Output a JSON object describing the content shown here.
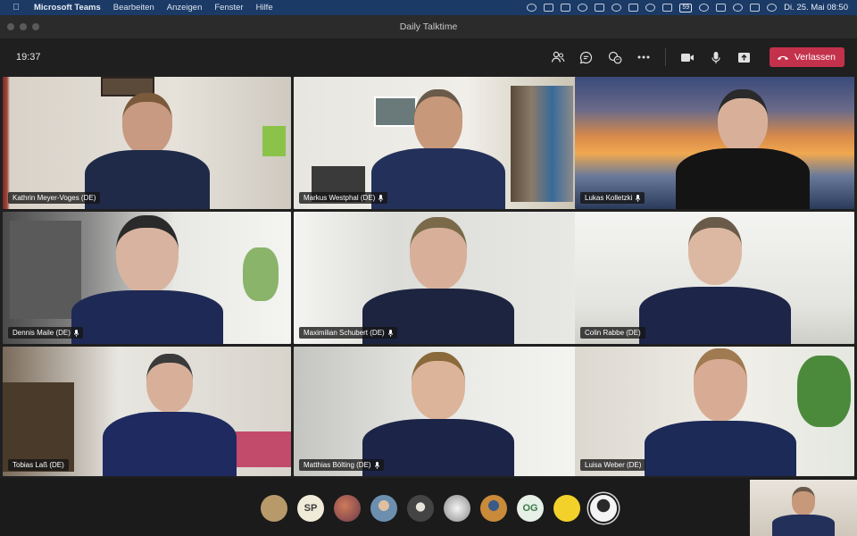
{
  "menubar": {
    "app_name": "Microsoft Teams",
    "menus": [
      "Bearbeiten",
      "Anzeigen",
      "Fenster",
      "Hilfe"
    ],
    "battery": "59",
    "clock": "Di. 25. Mai  08:50"
  },
  "window": {
    "title": "Daily Talktime"
  },
  "toolbar": {
    "timer": "19:37",
    "leave_label": "Verlassen",
    "icons": [
      "participants-icon",
      "chat-icon",
      "reactions-icon",
      "more-icon",
      "camera-icon",
      "microphone-icon",
      "share-icon"
    ]
  },
  "participants": [
    {
      "name": "Kathrin Meyer-Voges (DE)",
      "muted": false
    },
    {
      "name": "Markus Westphal (DE)",
      "muted": true
    },
    {
      "name": "Lukas Kolletzki",
      "muted": true
    },
    {
      "name": "Dennis Maile (DE)",
      "muted": true
    },
    {
      "name": "Maximilian Schubert (DE)",
      "muted": true
    },
    {
      "name": "Colin Rabbe (DE)",
      "muted": false
    },
    {
      "name": "Tobias Laß (DE)",
      "muted": false
    },
    {
      "name": "Matthias Bölting (DE)",
      "muted": true
    },
    {
      "name": "Luisa Weber (DE)",
      "muted": false
    }
  ],
  "strip_avatars": [
    {
      "initials": "",
      "color": "#b89a6a"
    },
    {
      "initials": "SP",
      "color": "#f0ebd8"
    },
    {
      "initials": "",
      "color": "#b05a4a"
    },
    {
      "initials": "",
      "color": "#6c8fb0"
    },
    {
      "initials": "",
      "color": "#444444"
    },
    {
      "initials": "",
      "color": "#8a8a8a"
    },
    {
      "initials": "",
      "color": "#c98a3a"
    },
    {
      "initials": "OG",
      "color": "#e6f0e6"
    },
    {
      "initials": "",
      "color": "#f2d12a"
    },
    {
      "initials": "",
      "color": "#f4f4f4"
    }
  ],
  "colors": {
    "leave": "#c4314b",
    "menubar": "#1b3a66"
  }
}
